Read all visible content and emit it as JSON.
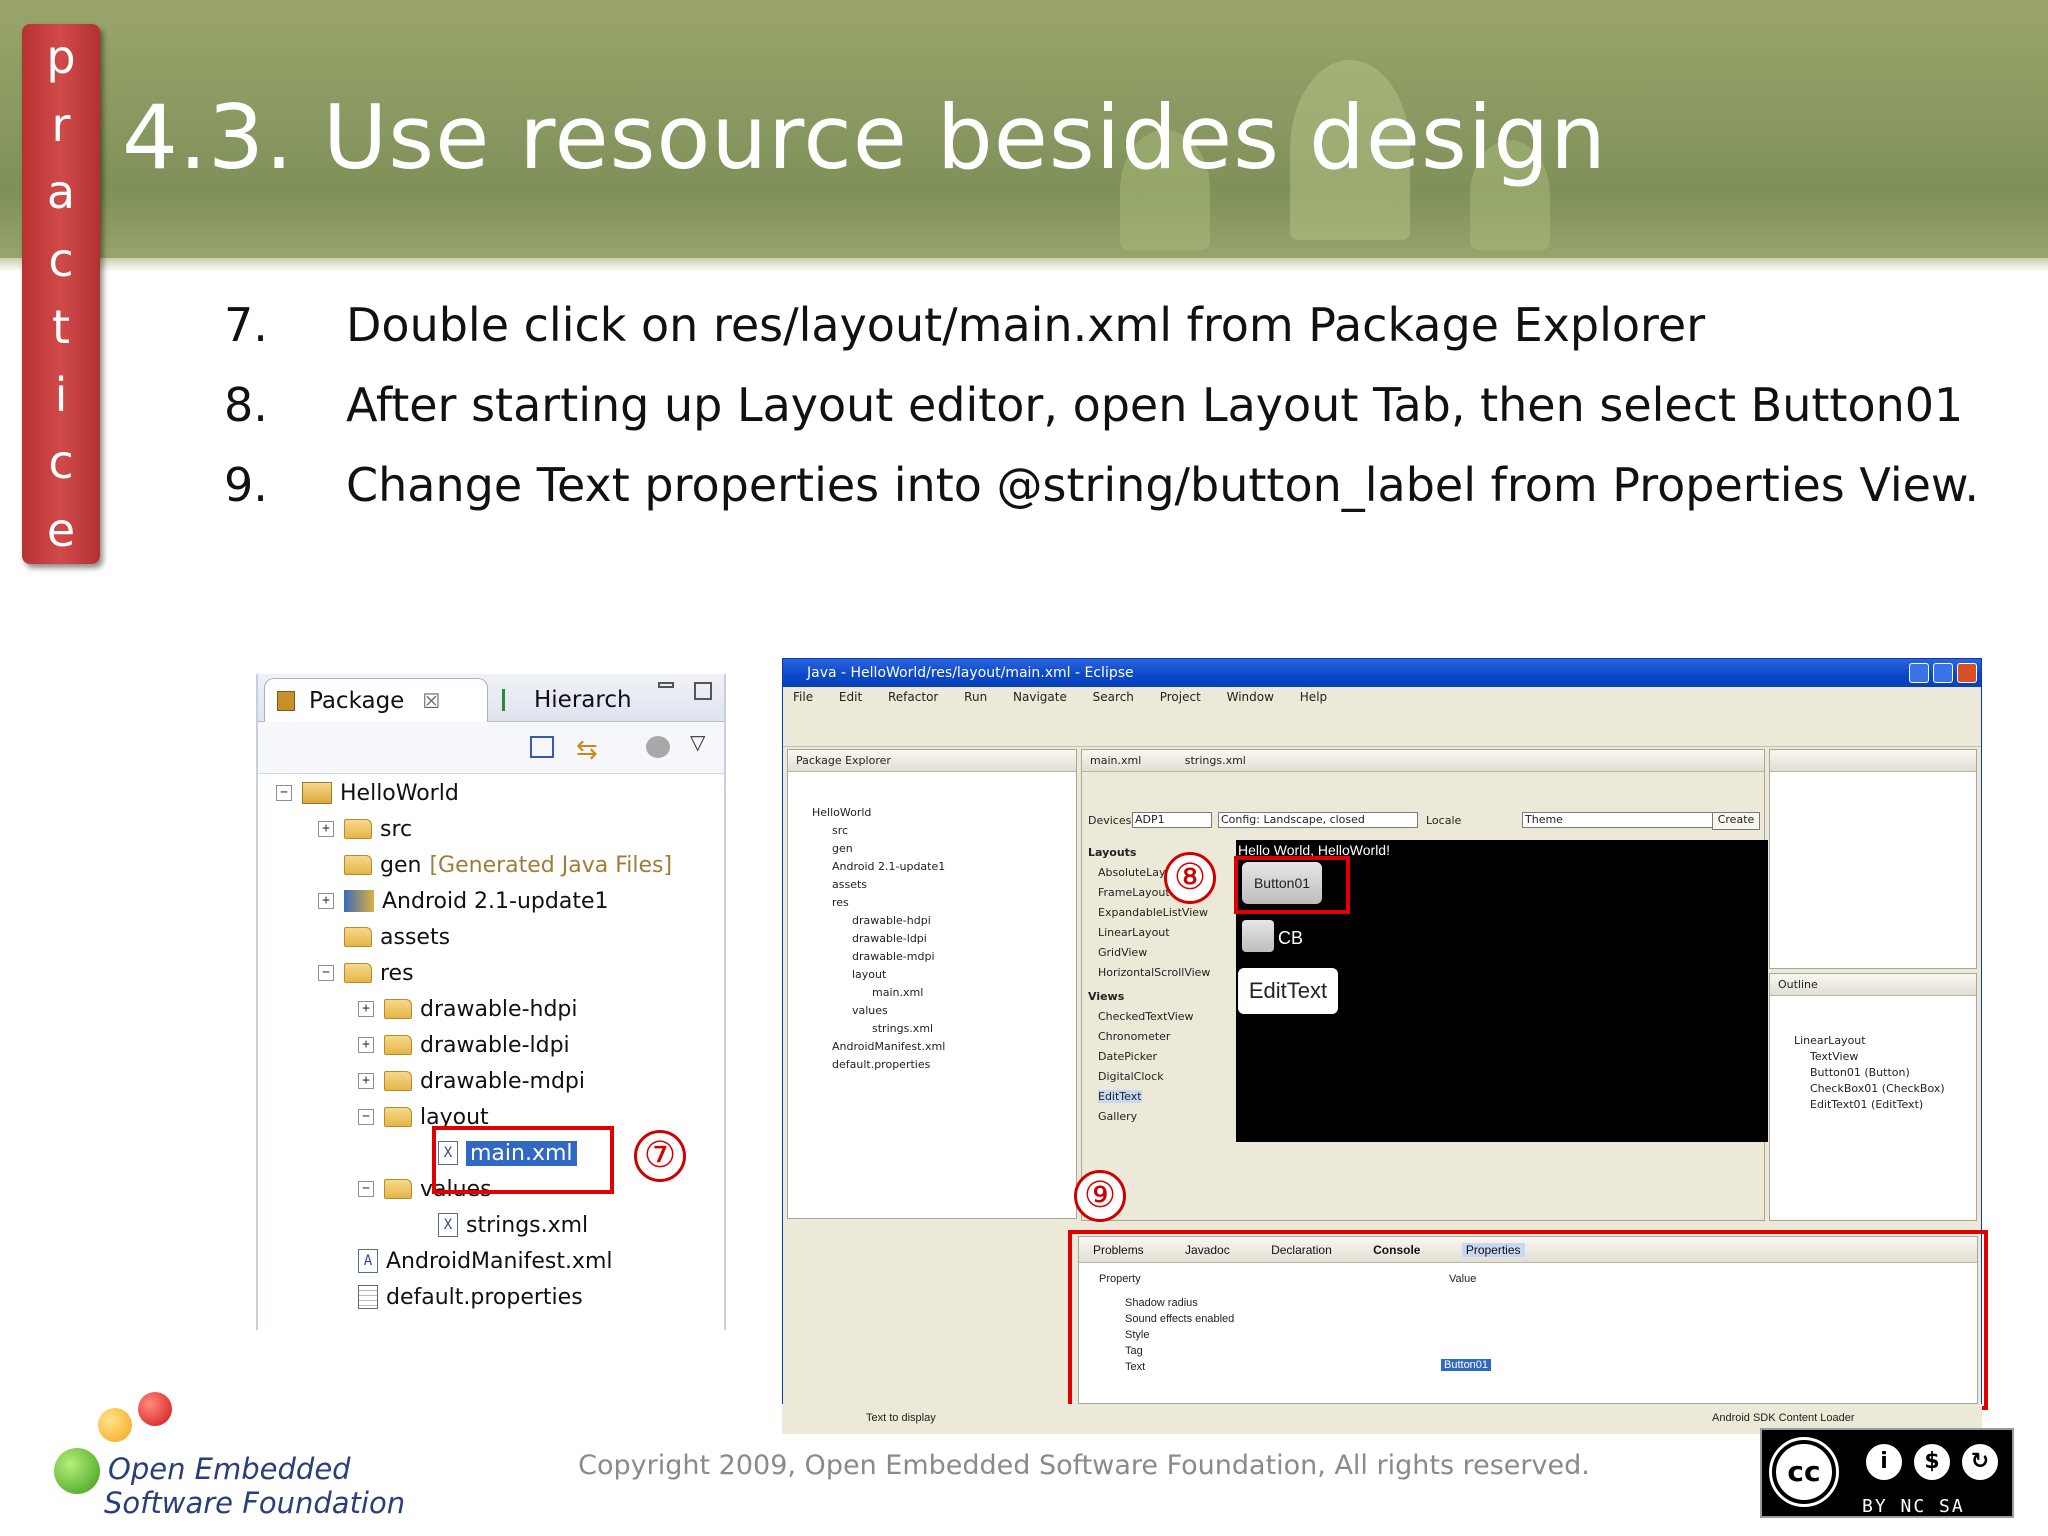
{
  "slide": {
    "title": "4.3. Use resource besides design",
    "practice_letters": [
      "p",
      "r",
      "a",
      "c",
      "t",
      "i",
      "c",
      "e"
    ]
  },
  "steps": [
    {
      "num": "7.",
      "text": "Double click on res/layout/main.xml from Package Explorer"
    },
    {
      "num": "8.",
      "text": "After starting up Layout editor, open Layout Tab, then select Button01"
    },
    {
      "num": "9.",
      "text": "Change Text properties into @string/button_label from Properties View."
    }
  ],
  "package_explorer": {
    "tab_label": "Package",
    "other_tab_label": "Hierarch",
    "tree": [
      {
        "label": "HelloWorld",
        "kind": "project"
      },
      {
        "label": "src",
        "kind": "folder"
      },
      {
        "label": "gen",
        "suffix": "[Generated Java Files]",
        "kind": "folder"
      },
      {
        "label": "Android 2.1-update1",
        "kind": "library"
      },
      {
        "label": "assets",
        "kind": "folder"
      },
      {
        "label": "res",
        "kind": "folder"
      },
      {
        "label": "drawable-hdpi",
        "kind": "folder"
      },
      {
        "label": "drawable-ldpi",
        "kind": "folder"
      },
      {
        "label": "drawable-mdpi",
        "kind": "folder"
      },
      {
        "label": "layout",
        "kind": "folder"
      },
      {
        "label": "main.xml",
        "kind": "xml"
      },
      {
        "label": "values",
        "kind": "folder"
      },
      {
        "label": "strings.xml",
        "kind": "xml"
      },
      {
        "label": "AndroidManifest.xml",
        "kind": "xml"
      },
      {
        "label": "default.properties",
        "kind": "file"
      }
    ]
  },
  "callouts": {
    "seven": "⑦",
    "eight": "⑧",
    "nine": "⑨"
  },
  "eclipse": {
    "window_title": "Java - HelloWorld/res/layout/main.xml - Eclipse",
    "menu": [
      "File",
      "Edit",
      "Refactor",
      "Run",
      "Navigate",
      "Search",
      "Project",
      "Window",
      "Help"
    ],
    "left_pane_title": "Package Explorer",
    "editor_tab": "main.xml",
    "editor_tab2": "strings.xml",
    "device_label": "Devices",
    "device_value": "ADP1",
    "config_value": "Config: Landscape, closed",
    "locale_label": "Locale",
    "theme_label": "Theme",
    "create_label": "Create",
    "hello_text": "Hello World, HelloWorld!",
    "button_text": "Button01",
    "checkbox_text": "CB",
    "edittext_text": "EditText",
    "layouts_header": "Layouts",
    "views_header": "Views",
    "palette_items": [
      "AbsoluteLayout",
      "FrameLayout",
      "ExpandableListView",
      "LinearLayout",
      "GridView",
      "HorizontalScrollView"
    ],
    "view_items": [
      "CheckedTextView",
      "Chronometer",
      "DatePicker",
      "DigitalClock",
      "EditText",
      "Gallery"
    ],
    "outline_title": "Outline",
    "outline_items": [
      "LinearLayout",
      "TextView",
      "Button01 (Button)",
      "CheckBox01 (CheckBox)",
      "EditText01 (EditText)"
    ],
    "bottom_tabs": [
      "Problems",
      "Javadoc",
      "Declaration",
      "Console",
      "Properties"
    ],
    "prop_header": "Property",
    "value_header": "Value",
    "properties": [
      "Shadow radius",
      "Sound effects enabled",
      "Style",
      "Tag",
      "Text"
    ],
    "text_value": "Button01",
    "status_left": "Text to display",
    "status_right": "Android SDK Content Loader"
  },
  "footer": {
    "logo_line1": "Open Embedded",
    "logo_line2": "Software Foundation",
    "copyright": "Copyright 2009, Open Embedded Software Foundation, All rights reserved.",
    "license_label": "BY  NC  SA"
  }
}
